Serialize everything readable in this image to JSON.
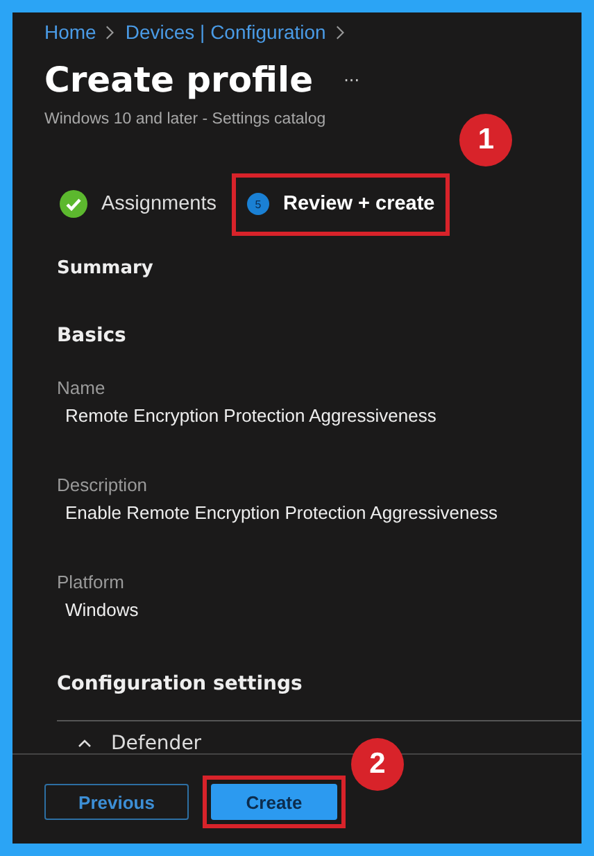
{
  "breadcrumb": [
    "Home",
    "Devices | Configuration"
  ],
  "title": "Create profile",
  "more": "···",
  "subtitle": "Windows 10 and later - Settings catalog",
  "tabs": [
    {
      "label": "Assignments",
      "kind": "done",
      "selected": false,
      "highlighted": false
    },
    {
      "label": "Review + create",
      "kind": "step",
      "number": "5",
      "selected": true,
      "highlighted": true,
      "callout": "1"
    }
  ],
  "summary": "Summary",
  "basics": {
    "heading": "Basics",
    "fields": [
      {
        "label": "Name",
        "value": "Remote Encryption Protection Aggressiveness"
      },
      {
        "label": "Description",
        "value": "Enable Remote Encryption Protection Aggressiveness"
      },
      {
        "label": "Platform",
        "value": "Windows"
      }
    ]
  },
  "configuration": {
    "heading": "Configuration settings",
    "groups": [
      {
        "label": "Defender",
        "expanded": true
      }
    ]
  },
  "footer": {
    "buttons": [
      {
        "label": "Previous",
        "kind": "secondary",
        "highlighted": false
      },
      {
        "label": "Create",
        "kind": "primary",
        "highlighted": true,
        "callout": "2"
      }
    ]
  }
}
